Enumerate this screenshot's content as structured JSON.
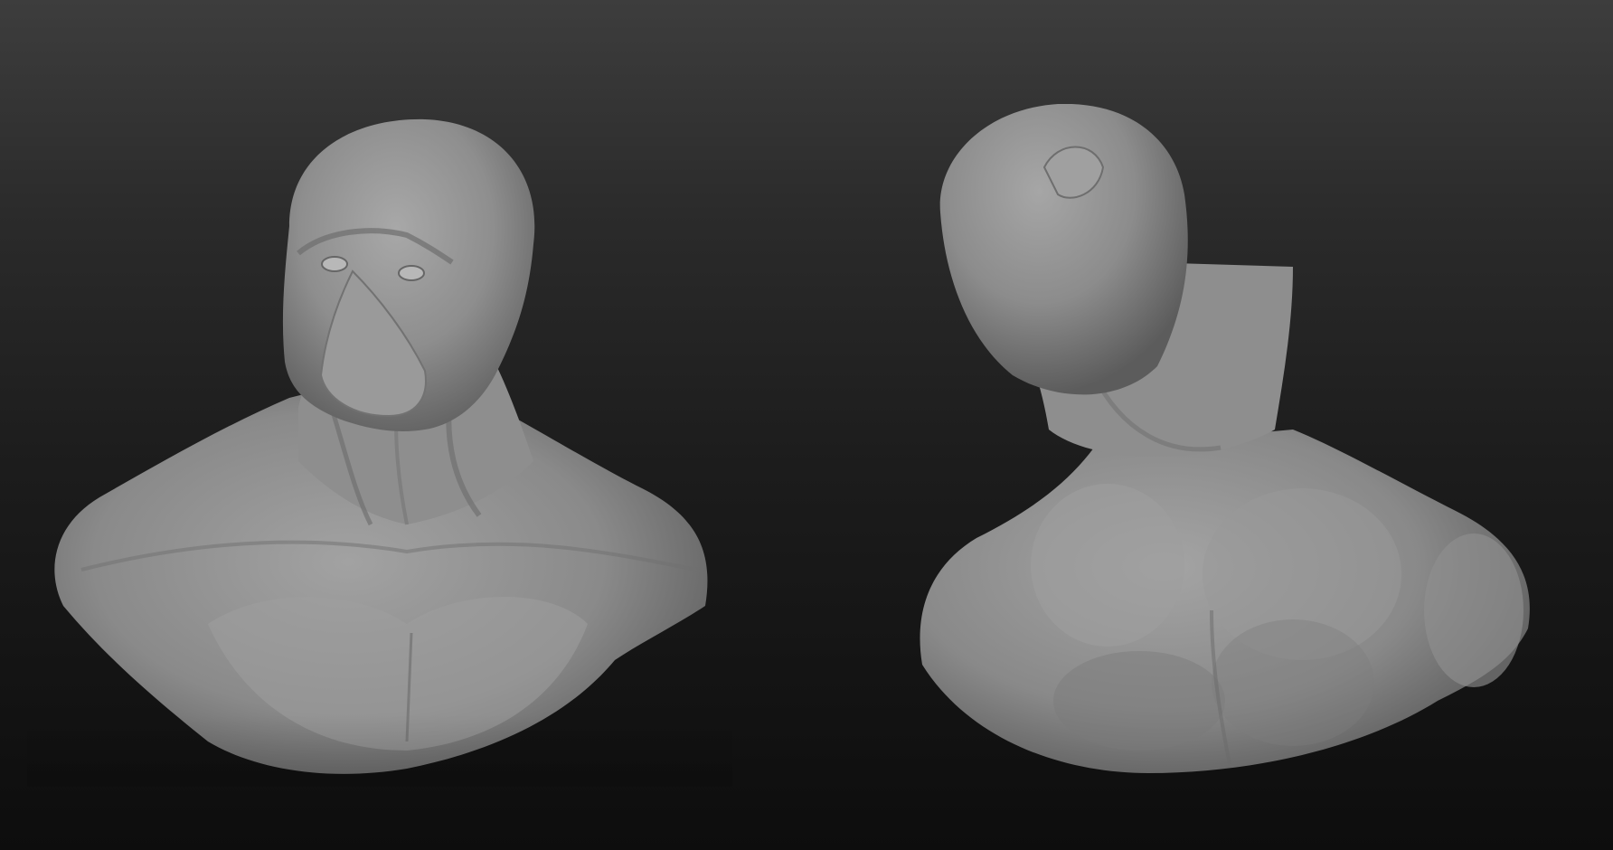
{
  "scene": {
    "background_top": "#3d3d3d",
    "background_bottom": "#0d0d0d",
    "material_color": "#8c8c8c"
  },
  "models": [
    {
      "id": "front",
      "view": "front-three-quarter"
    },
    {
      "id": "back",
      "view": "back-three-quarter"
    }
  ]
}
